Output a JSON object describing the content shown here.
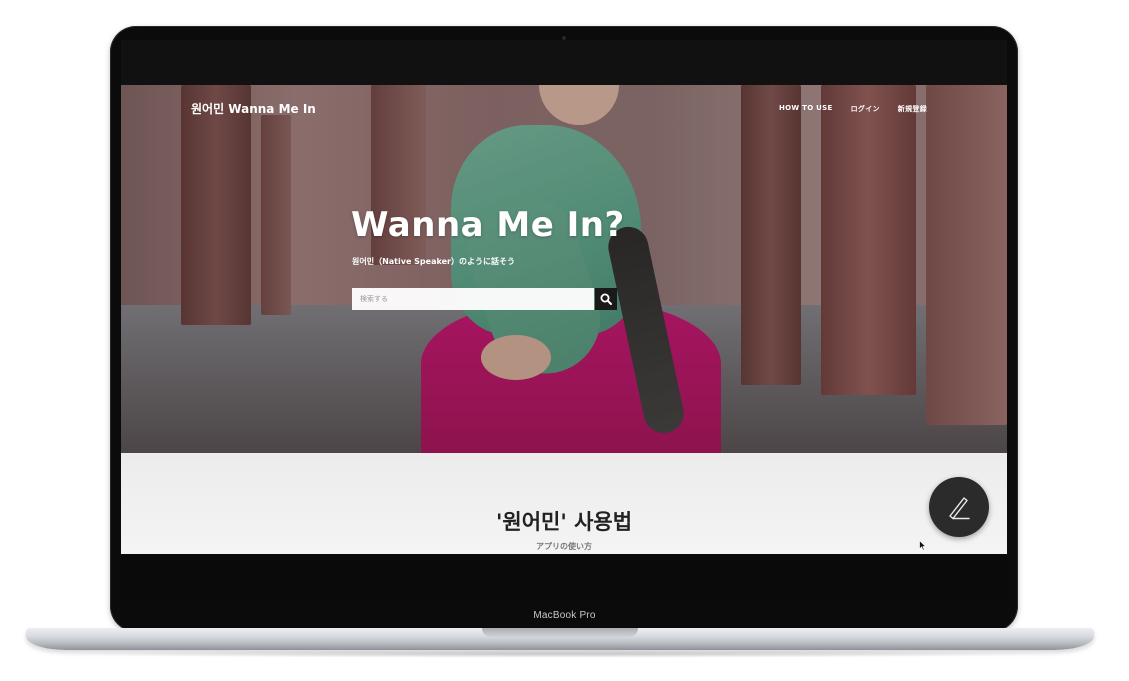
{
  "device": {
    "label": "MacBook Pro"
  },
  "site": {
    "brand": "원어민 Wanna Me In",
    "nav": [
      {
        "label": "HOW TO USE"
      },
      {
        "label": "ログイン"
      },
      {
        "label": "新規登録"
      }
    ]
  },
  "hero": {
    "title": "Wanna Me In?",
    "subtitle": "원어민（Native Speaker）のように話そう",
    "search_placeholder": "検索する",
    "search_icon": "search-icon"
  },
  "how_section": {
    "title": "'원어민' 사용법",
    "subtitle": "アプリの使い方"
  },
  "fab": {
    "icon": "pencil-icon"
  },
  "colors": {
    "search_button": "#1a1a1a",
    "fab": "#2b2b2b",
    "frame": "#0b0b0c"
  }
}
